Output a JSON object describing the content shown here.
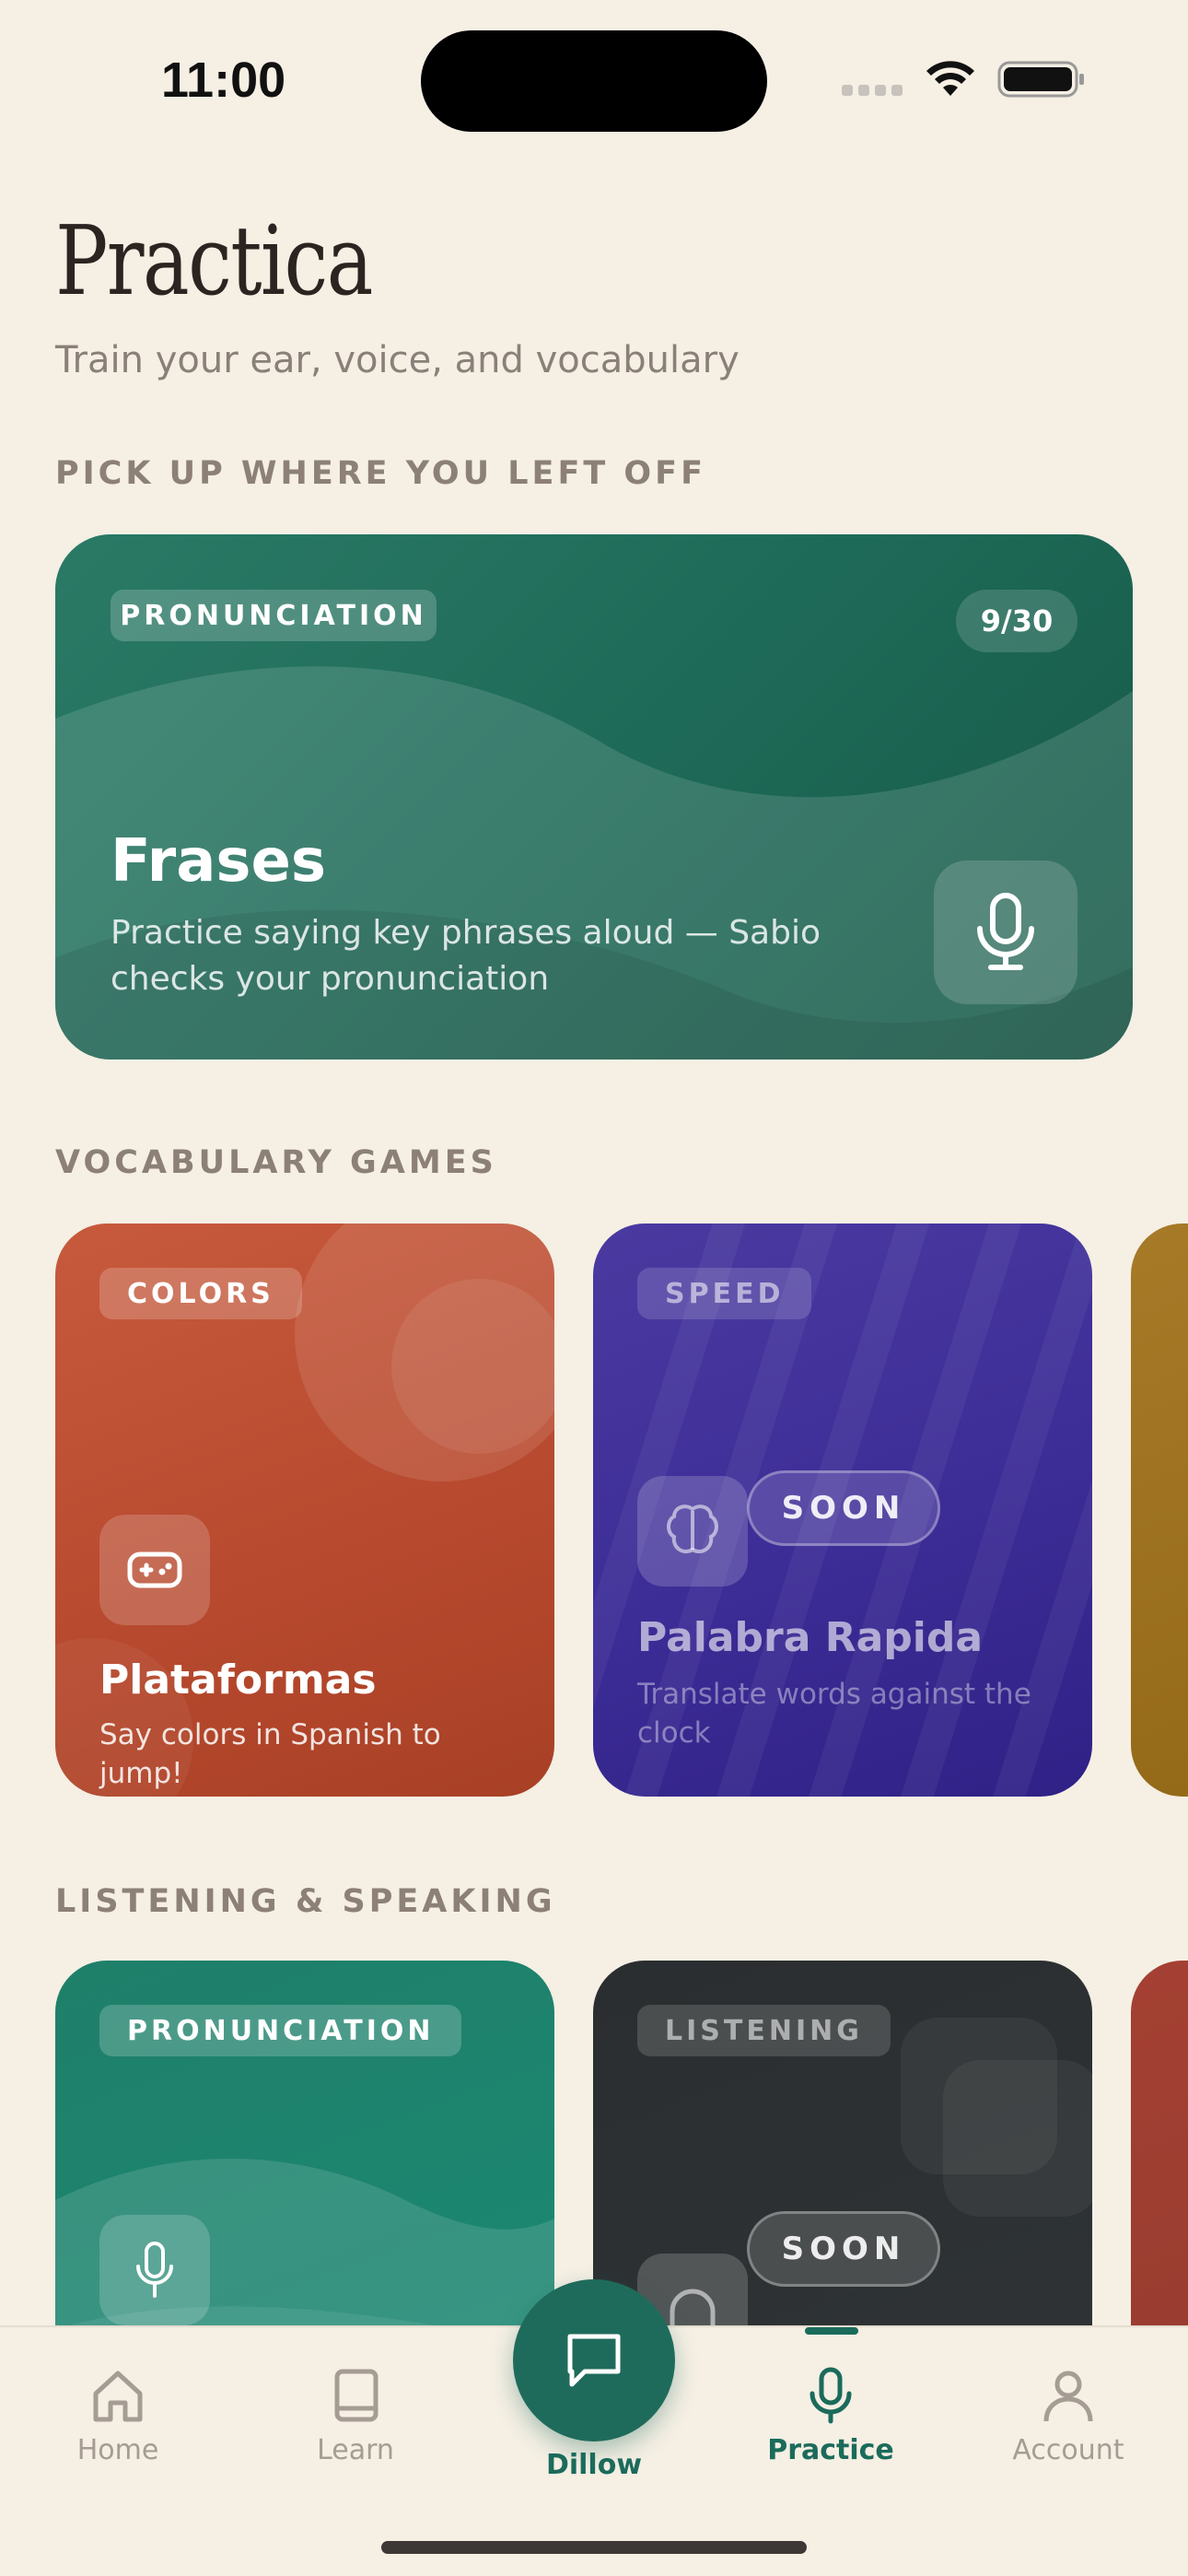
{
  "status_bar": {
    "time": "11:00"
  },
  "header": {
    "title": "Practica",
    "subtitle": "Train your ear, voice, and vocabulary"
  },
  "sections": {
    "continue": "PICK UP WHERE YOU LEFT OFF",
    "vocabulary": "VOCABULARY GAMES",
    "listening": "LISTENING & SPEAKING"
  },
  "hero": {
    "category": "PRONUNCIATION",
    "progress": "9/30",
    "title": "Frases",
    "description": "Practice saying key phrases aloud — Sabio checks your pronunciation",
    "icon": "microphone-icon"
  },
  "vocabulary_games": [
    {
      "tag": "COLORS",
      "title": "Plataformas",
      "description": "Say colors in Spanish to jump!",
      "icon": "gamepad-icon",
      "color": "#b84a2f"
    },
    {
      "tag": "SPEED",
      "title": "Palabra Rapida",
      "description": "Translate words against the clock",
      "icon": "brain-icon",
      "badge": "SOON",
      "color": "#3c2c96"
    },
    {
      "color": "#8f6514"
    }
  ],
  "listening_games": [
    {
      "tag": "PRONUNCIATION",
      "icon": "microphone-icon",
      "color": "#1c8670"
    },
    {
      "tag": "LISTENING",
      "icon": "headphones-icon",
      "badge": "SOON",
      "color": "#2f3436"
    },
    {
      "color": "#8f3a2d"
    }
  ],
  "tab_bar": {
    "items": [
      {
        "label": "Home",
        "icon": "home-icon"
      },
      {
        "label": "Learn",
        "icon": "book-icon"
      },
      {
        "label": "Dillow",
        "icon": "chat-icon"
      },
      {
        "label": "Practice",
        "icon": "microphone-icon",
        "active": true
      },
      {
        "label": "Account",
        "icon": "person-icon"
      }
    ]
  },
  "colors": {
    "background": "#f5efe4",
    "accent": "#1b6b5b"
  }
}
